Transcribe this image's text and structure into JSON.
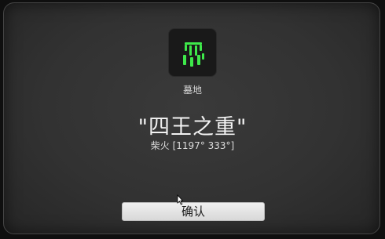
{
  "dialog": {
    "icon": "grave-marker-icon",
    "accent_color": "#3ee84a",
    "place_label": "墓地",
    "title": "\"四王之重\"",
    "coordinates": "柴火 [1197° 333°]",
    "confirm_label": "确认"
  }
}
